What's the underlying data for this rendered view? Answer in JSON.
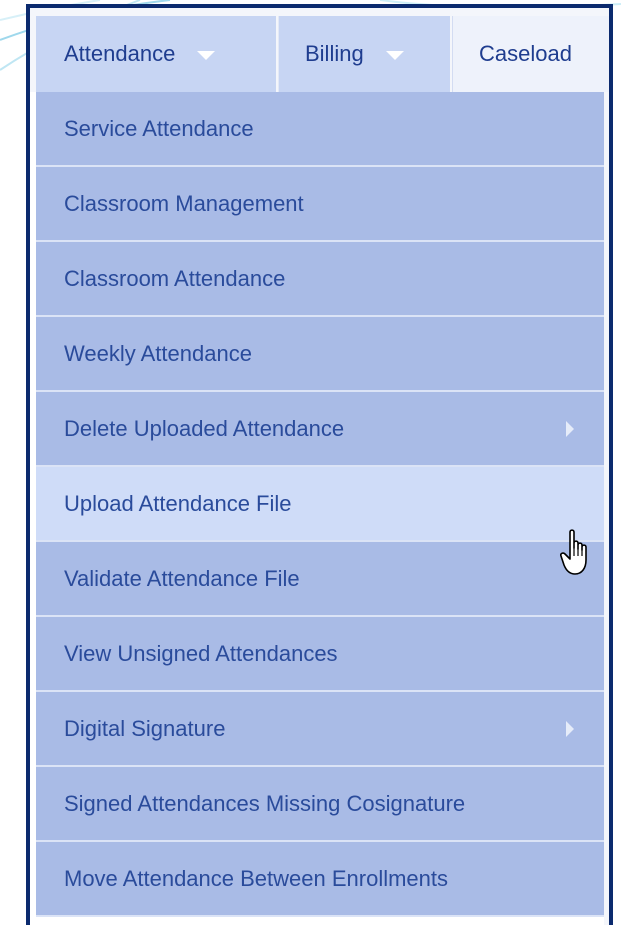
{
  "navbar": {
    "tabs": [
      {
        "label": "Attendance",
        "has_dropdown": true,
        "active": true
      },
      {
        "label": "Billing",
        "has_dropdown": true,
        "active": false
      },
      {
        "label": "Caseload",
        "has_dropdown": false,
        "active": false
      }
    ]
  },
  "menu": {
    "items": [
      {
        "label": "Service Attendance",
        "has_submenu": false,
        "hovered": false
      },
      {
        "label": "Classroom Management",
        "has_submenu": false,
        "hovered": false
      },
      {
        "label": "Classroom Attendance",
        "has_submenu": false,
        "hovered": false
      },
      {
        "label": "Weekly Attendance",
        "has_submenu": false,
        "hovered": false
      },
      {
        "label": "Delete Uploaded Attendance",
        "has_submenu": true,
        "hovered": false
      },
      {
        "label": "Upload Attendance File",
        "has_submenu": false,
        "hovered": true
      },
      {
        "label": "Validate Attendance File",
        "has_submenu": false,
        "hovered": false
      },
      {
        "label": "View Unsigned Attendances",
        "has_submenu": false,
        "hovered": false
      },
      {
        "label": "Digital Signature",
        "has_submenu": true,
        "hovered": false
      },
      {
        "label": "Signed Attendances Missing Cosignature",
        "has_submenu": false,
        "hovered": false
      },
      {
        "label": "Move Attendance Between Enrollments",
        "has_submenu": false,
        "hovered": false
      }
    ]
  },
  "colors": {
    "frame_border": "#0b2a6e",
    "tab_bg": "#c7d5f3",
    "menu_bg": "#a9bbe6",
    "menu_hover_bg": "#cfdcf8",
    "text": "#2a4b9b"
  },
  "icons": {
    "cursor": "hand-pointer-icon",
    "dropdown": "caret-down-icon",
    "submenu": "caret-right-icon"
  }
}
